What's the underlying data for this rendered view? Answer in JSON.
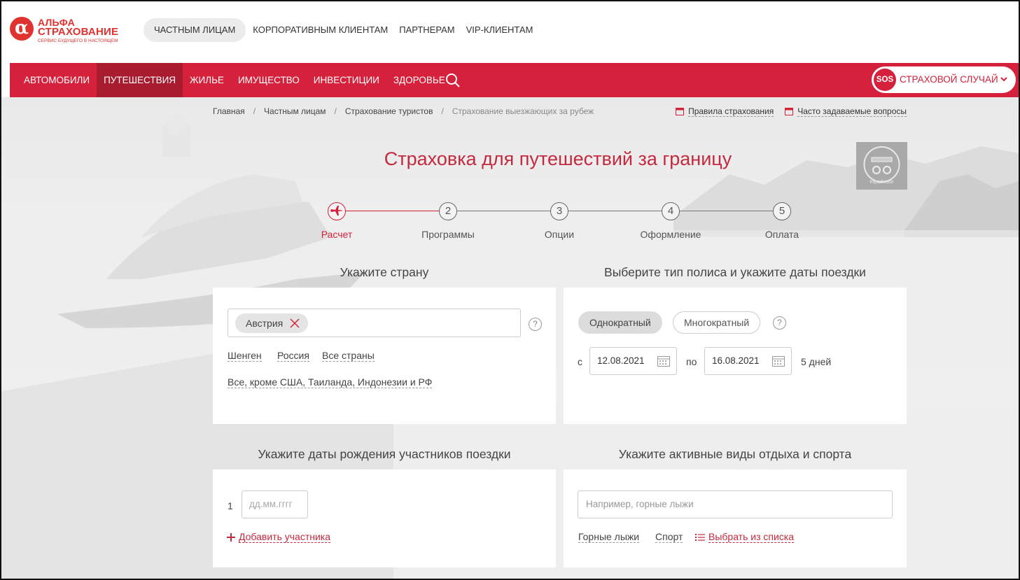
{
  "header": {
    "logo": {
      "line1": "АЛЬФА",
      "line2": "СТРАХОВАНИЕ",
      "tagline": "СЕРВИС БУДУЩЕГО В НАСТОЯЩЕМ",
      "mark": "α"
    },
    "top_nav": [
      "ЧАСТНЫМ ЛИЦАМ",
      "КОРПОРАТИВНЫМ КЛИЕНТАМ",
      "ПАРТНЕРАМ",
      "VIP-КЛИЕНТАМ"
    ],
    "top_nav_active": "ЧАСТНЫМ ЛИЦАМ"
  },
  "main_nav": {
    "items": [
      "АВТОМОБИЛИ",
      "ПУТЕШЕСТВИЯ",
      "ЖИЛЬЕ",
      "ИМУЩЕСТВО",
      "ИНВЕСТИЦИИ",
      "ЗДОРОВЬЕ"
    ],
    "active": "ПУТЕШЕСТВИЯ",
    "search_icon": "search-icon",
    "sos": {
      "badge": "SOS",
      "label": "СТРАХОВОЙ СЛУЧАЙ"
    }
  },
  "breadcrumb": {
    "items": [
      "Главная",
      "Частным лицам",
      "Страхование туристов",
      "Страхование выезжающих за рубеж"
    ],
    "separator": "/"
  },
  "top_links": {
    "rules": "Правила страхования",
    "faq": "Часто задаваемые вопросы"
  },
  "page_title": "Страховка для путешествий за границу",
  "badge_label": "tripadvisor",
  "stepper": {
    "steps": [
      {
        "num": "",
        "label": "Расчет",
        "active": true
      },
      {
        "num": "2",
        "label": "Программы",
        "active": false
      },
      {
        "num": "3",
        "label": "Опции",
        "active": false
      },
      {
        "num": "4",
        "label": "Оформление",
        "active": false
      },
      {
        "num": "5",
        "label": "Оплата",
        "active": false
      }
    ]
  },
  "country": {
    "section_title": "Укажите страну",
    "selected_chip": "Австрия",
    "help": "?",
    "quick_links": [
      "Шенген",
      "Россия",
      "Все страны"
    ],
    "extra_link": "Все, кроме США, Таиланда, Индонезии и РФ"
  },
  "policy": {
    "section_title": "Выберите тип полиса и укажите даты поездки",
    "types": [
      "Однократный",
      "Многократный"
    ],
    "selected_type": "Однократный",
    "help": "?",
    "from_label": "с",
    "from_date": "12.08.2021",
    "to_label": "по",
    "to_date": "16.08.2021",
    "duration": "5 дней"
  },
  "travelers": {
    "section_title": "Укажите даты рождения участников поездки",
    "index": "1",
    "placeholder": "дд.мм.гггг",
    "add_label": "Добавить участника"
  },
  "sports": {
    "section_title": "Укажите активные виды отдыха и спорта",
    "placeholder": "Например, горные лыжи",
    "quick_links": [
      "Горные лыжи",
      "Спорт"
    ],
    "list_link": "Выбрать из списка"
  },
  "colors": {
    "brand_red": "#d5213b",
    "nav_active": "#a91b2f",
    "title_red": "#c42a3f"
  }
}
